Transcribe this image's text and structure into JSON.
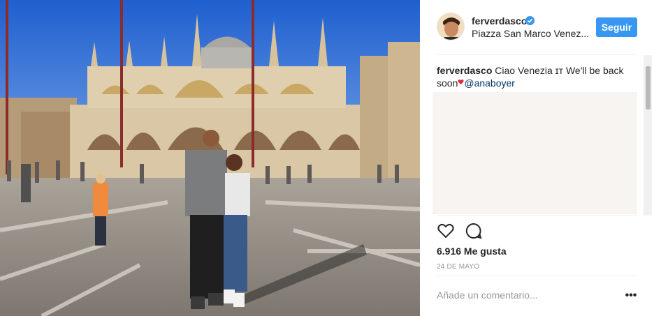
{
  "post": {
    "username": "ferverdasco",
    "location": "Piazza San Marco Venez...",
    "follow_label": "Seguir",
    "caption_text": "Ciao Venezia ɪᴛ We'll be back soon",
    "mention": "@anaboyer",
    "likes": "6.916 Me gusta",
    "date": "24 DE MAYO",
    "comment_placeholder": "Añade un comentario...",
    "more_label": "•••"
  },
  "icons": {
    "verified": "verified-badge-icon",
    "like": "heart-outline-icon",
    "comment": "speech-bubble-icon",
    "caption_emoji": "red-heart-emoji-icon",
    "more": "ellipsis-icon"
  },
  "colors": {
    "accent": "#3897f0",
    "mention": "#003569",
    "muted": "#999999",
    "divider": "#efefef"
  }
}
